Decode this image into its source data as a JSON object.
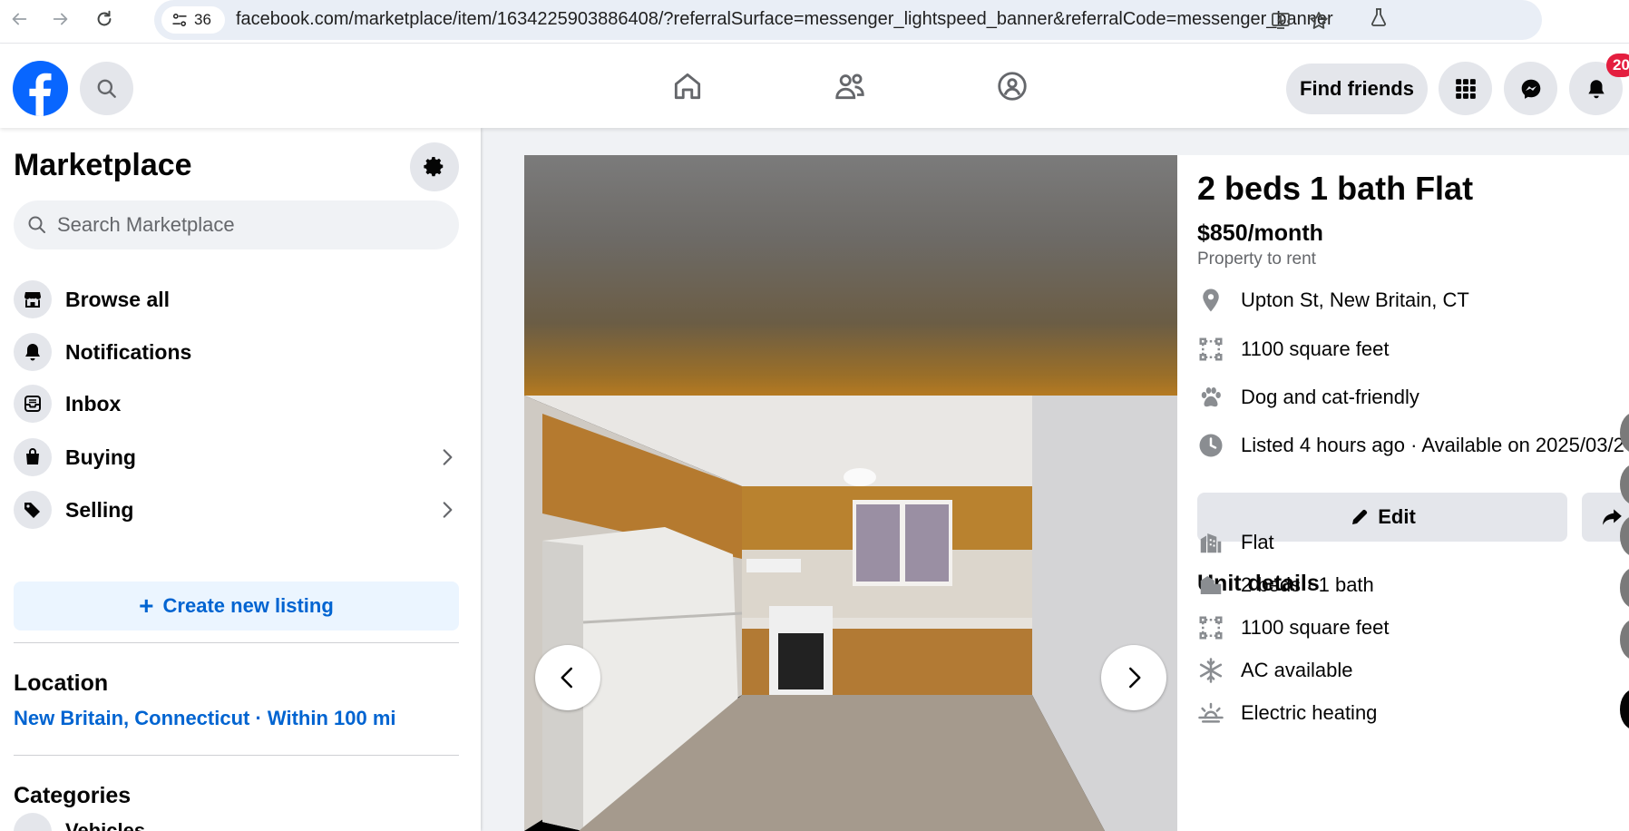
{
  "browser": {
    "tab_count": "36",
    "url": "facebook.com/marketplace/item/1634225903886408/?referralSurface=messenger_lightspeed_banner&referralCode=messenger_banner"
  },
  "header": {
    "find_friends_label": "Find friends",
    "notification_count": "20"
  },
  "sidebar": {
    "title": "Marketplace",
    "search_placeholder": "Search Marketplace",
    "items": [
      {
        "label": "Browse all"
      },
      {
        "label": "Notifications"
      },
      {
        "label": "Inbox"
      },
      {
        "label": "Buying"
      },
      {
        "label": "Selling"
      }
    ],
    "create_listing_label": "Create new listing",
    "location_heading": "Location",
    "location_value": "New Britain, Connecticut · Within 100 mi",
    "categories_heading": "Categories",
    "category_cut": "Vehicles"
  },
  "listing": {
    "title": "2 beds 1 bath Flat",
    "price": "$850/month",
    "category": "Property to rent",
    "address": "Upton St, New Britain, CT",
    "area": "1100 square feet",
    "pets": "Dog and cat-friendly",
    "listed": "Listed 4 hours ago · Available on 2025/03/2",
    "edit_label": "Edit",
    "unit_details_heading": "Unit details",
    "unit_details": [
      {
        "label": "Flat",
        "icon": "building-icon"
      },
      {
        "label": "2 beds · 1 bath",
        "icon": "bed-icon"
      },
      {
        "label": "1100 square feet",
        "icon": "area-icon"
      },
      {
        "label": "AC available",
        "icon": "snowflake-icon"
      },
      {
        "label": "Electric heating",
        "icon": "heat-icon"
      }
    ]
  },
  "colors": {
    "brand": "#0866ff",
    "link": "#0064d1",
    "badge": "#e41e3f"
  }
}
